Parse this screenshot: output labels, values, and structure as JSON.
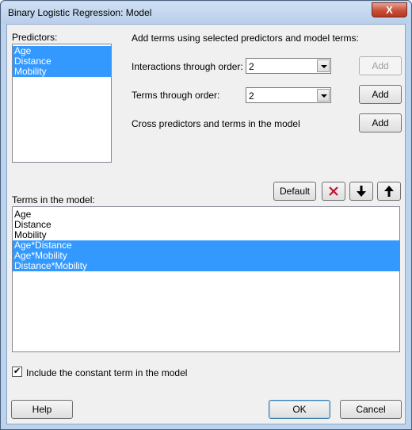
{
  "window": {
    "title": "Binary Logistic Regression: Model",
    "close_glyph": "X"
  },
  "predictors": {
    "label": "Predictors:",
    "items": [
      {
        "label": "Age"
      },
      {
        "label": "Distance"
      },
      {
        "label": "Mobility"
      }
    ]
  },
  "add_terms_header": "Add terms using selected predictors and model terms:",
  "interactions": {
    "label": "Interactions through order:",
    "value": "2",
    "button": "Add"
  },
  "terms_order": {
    "label": "Terms through order:",
    "value": "2",
    "button": "Add"
  },
  "cross": {
    "label": "Cross predictors and terms in the model",
    "button": "Add"
  },
  "terms_toolbar": {
    "default_label": "Default"
  },
  "terms": {
    "label": "Terms in the model:",
    "items": [
      {
        "label": "Age"
      },
      {
        "label": "Distance"
      },
      {
        "label": "Mobility"
      },
      {
        "label": "Age*Distance"
      },
      {
        "label": "Age*Mobility"
      },
      {
        "label": "Distance*Mobility"
      }
    ]
  },
  "constant_term": {
    "label": "Include the constant term in the model",
    "checked": true
  },
  "footer": {
    "help": "Help",
    "ok": "OK",
    "cancel": "Cancel"
  },
  "colors": {
    "selection": "#3399ff",
    "delete_icon": "#c8102e",
    "window_frame": "#bcd3ee"
  }
}
